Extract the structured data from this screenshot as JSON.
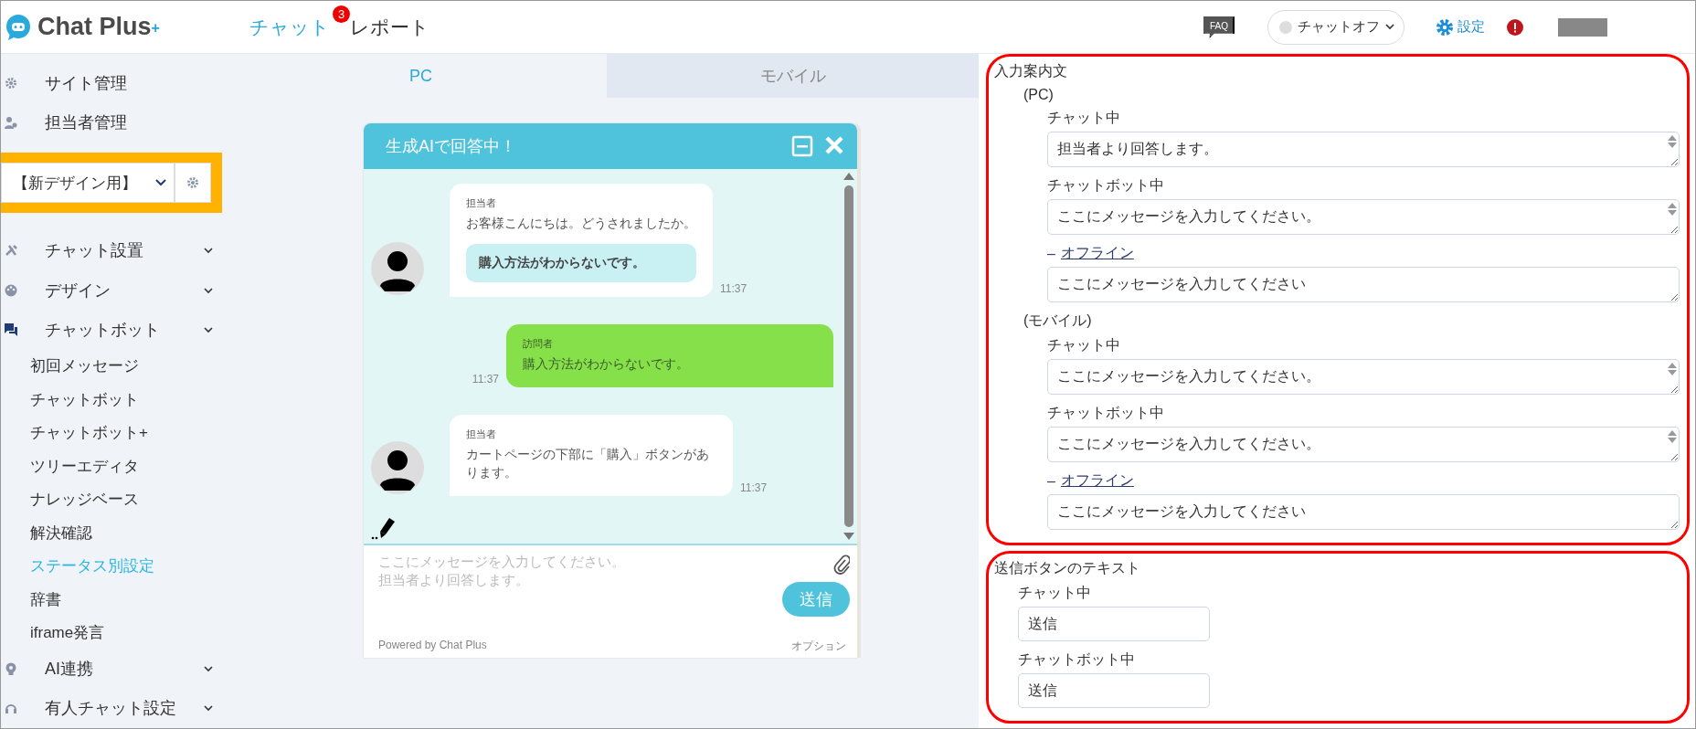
{
  "header": {
    "logo": "Chat Plus",
    "logo_mark": "+",
    "nav": [
      {
        "label": "チャット",
        "selected": true,
        "badge": "3"
      },
      {
        "label": "レポート",
        "selected": false
      }
    ],
    "faq": "FAQ",
    "status_select": "チャットオフ",
    "settings": "設定"
  },
  "sidebar": {
    "items": [
      {
        "kind": "link",
        "label": "サイト管理"
      },
      {
        "kind": "link",
        "label": "担当者管理"
      },
      {
        "kind": "site-select",
        "value": "【新デザイン用】"
      },
      {
        "kind": "group",
        "label": "チャット設置",
        "expanded": false
      },
      {
        "kind": "group",
        "label": "デザイン",
        "expanded": false
      },
      {
        "kind": "group",
        "label": "チャットボット",
        "expanded": true,
        "children": [
          {
            "label": "初回メッセージ",
            "selected": false
          },
          {
            "label": "チャットボット",
            "selected": false
          },
          {
            "label": "チャットボット+",
            "selected": false
          },
          {
            "label": "ツリーエディタ",
            "selected": false
          },
          {
            "label": "ナレッジベース",
            "selected": false
          },
          {
            "label": "解決確認",
            "selected": false
          },
          {
            "label": "ステータス別設定",
            "selected": true
          },
          {
            "label": "辞書",
            "selected": false
          },
          {
            "label": "iframe発言",
            "selected": false
          }
        ]
      },
      {
        "kind": "group",
        "label": "AI連携",
        "expanded": false
      },
      {
        "kind": "group",
        "label": "有人チャット設定",
        "expanded": false
      }
    ]
  },
  "preview": {
    "tabs": [
      {
        "label": "PC",
        "selected": true
      },
      {
        "label": "モバイル",
        "selected": false
      }
    ],
    "widget": {
      "title": "生成AIで回答中！",
      "messages": [
        {
          "kind": "agent",
          "sender": "担当者",
          "text": "お客様こんにちは。どうされましたか。",
          "options": [
            "購入方法がわからないです。"
          ],
          "time": "11:37"
        },
        {
          "kind": "visitor",
          "sender": "訪問者",
          "text": "購入方法がわからないです。",
          "time": "11:37"
        },
        {
          "kind": "agent",
          "sender": "担当者",
          "text": "カートページの下部に「購入」ボタンがあります。",
          "time": "11:37"
        }
      ],
      "input_placeholder_lines": [
        "ここにメッセージを入力してください。",
        "担当者より回答します。"
      ],
      "send": "送信",
      "powered_by": "Powered by Chat Plus",
      "option_link": "オプション"
    }
  },
  "settings": {
    "sections": [
      {
        "title": "入力案内文",
        "highlighted": true,
        "groups": [
          {
            "label": "(PC)",
            "fields": [
              {
                "kind": "textarea",
                "label": "チャット中",
                "value": "担当者より回答します。",
                "spinner": true
              },
              {
                "kind": "textarea",
                "label": "チャットボット中",
                "value": "ここにメッセージを入力してください。",
                "spinner": true
              },
              {
                "kind": "textarea",
                "label": "オフライン",
                "prefix": "–",
                "label_link": true,
                "value": "ここにメッセージを入力してください",
                "spinner": false
              }
            ]
          },
          {
            "label": "(モバイル)",
            "fields": [
              {
                "kind": "textarea",
                "label": "チャット中",
                "value": "ここにメッセージを入力してください。",
                "spinner": true
              },
              {
                "kind": "textarea",
                "label": "チャットボット中",
                "value": "ここにメッセージを入力してください。",
                "spinner": true
              },
              {
                "kind": "textarea",
                "label": "オフライン",
                "prefix": "–",
                "label_link": true,
                "value": "ここにメッセージを入力してください",
                "spinner": false
              }
            ]
          }
        ]
      },
      {
        "title": "送信ボタンのテキスト",
        "highlighted": true,
        "groups": [
          {
            "fields": [
              {
                "kind": "input",
                "label": "チャット中",
                "value": "送信"
              },
              {
                "kind": "input",
                "label": "チャットボット中",
                "value": "送信"
              }
            ]
          }
        ]
      }
    ]
  }
}
